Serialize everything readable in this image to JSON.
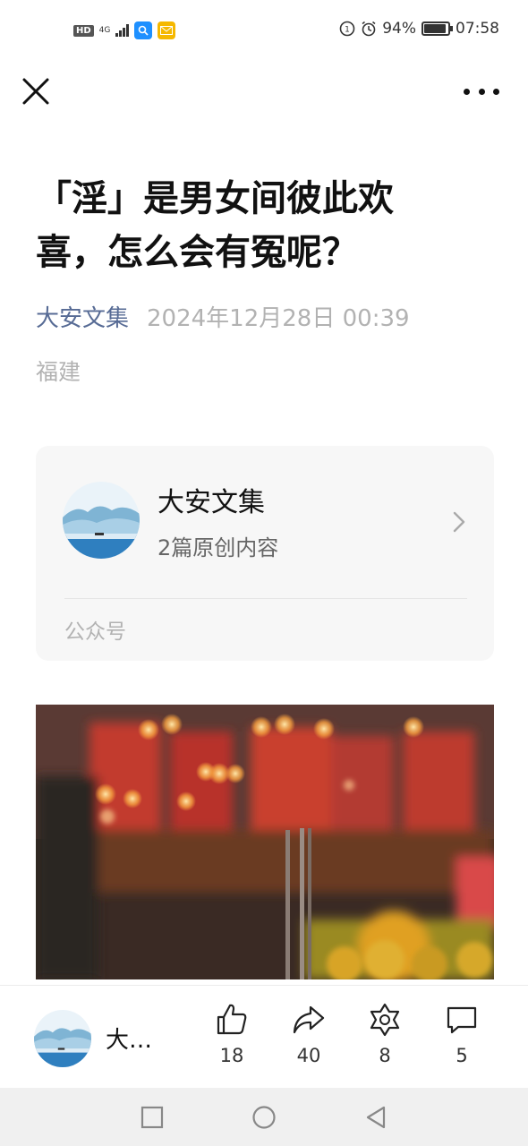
{
  "status_bar": {
    "hd_label": "HD",
    "network_label": "4G",
    "battery_percent": "94%",
    "battery_level": 0.94,
    "time": "07:58"
  },
  "nav": {
    "close_icon": "close-icon",
    "more_icon": "more-icon"
  },
  "article": {
    "title": "「淫」是男女间彼此欢喜，怎么会有冤呢？",
    "author": "大安文集",
    "date": "2024年12月28日 00:39",
    "location": "福建"
  },
  "account_card": {
    "name": "大安文集",
    "subtitle": "2篇原创内容",
    "type_label": "公众号"
  },
  "action_bar": {
    "author_short": "大…",
    "like_count": "18",
    "share_count": "40",
    "recommend_count": "8",
    "comment_count": "5"
  },
  "colors": {
    "author_link": "#576b95",
    "muted_text": "#b2b2b2",
    "card_bg": "#f7f7f7"
  }
}
